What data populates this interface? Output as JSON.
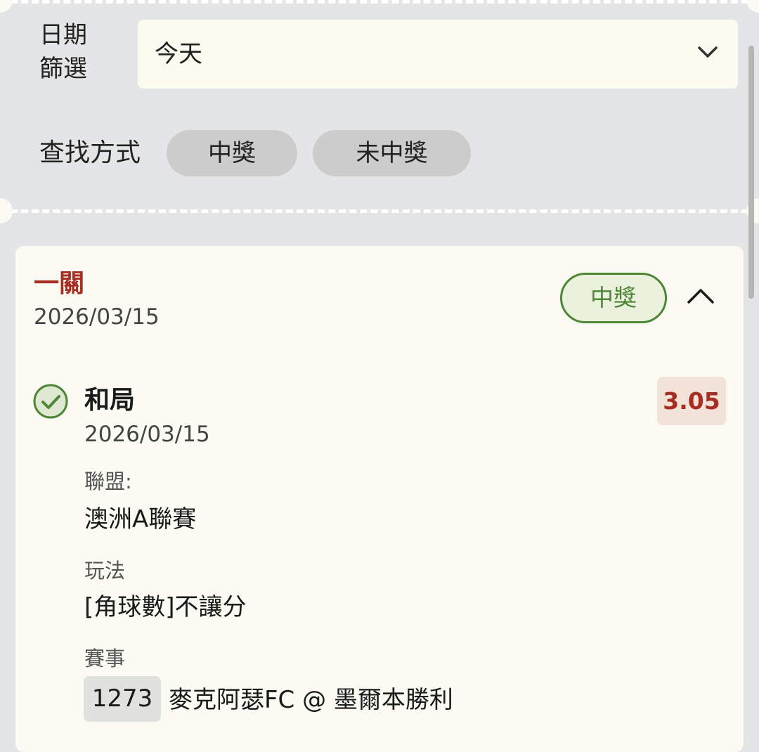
{
  "filters": {
    "date_label_line1": "日期",
    "date_label_line2": "篩選",
    "date_value": "今天",
    "search_label": "查找方式",
    "options": [
      "中獎",
      "未中獎"
    ]
  },
  "ticket": {
    "bet_type": "一關",
    "date": "2026/03/15",
    "status": "中獎",
    "selection": {
      "title": "和局",
      "date": "2026/03/15",
      "odds": "3.05",
      "league_label": "聯盟:",
      "league": "澳洲A聯賽",
      "play_label": "玩法",
      "play": "[角球數]不讓分",
      "match_label": "賽事",
      "match_number": "1273",
      "match": "麥克阿瑟FC @ 墨爾本勝利"
    }
  },
  "colors": {
    "accent_red": "#a62e22",
    "win_green": "#4e8636",
    "card_bg": "#fbfbf3",
    "page_bg": "#e4e5e6"
  },
  "icons": [
    "chevron-down-icon",
    "chevron-up-icon",
    "check-circle-icon"
  ]
}
